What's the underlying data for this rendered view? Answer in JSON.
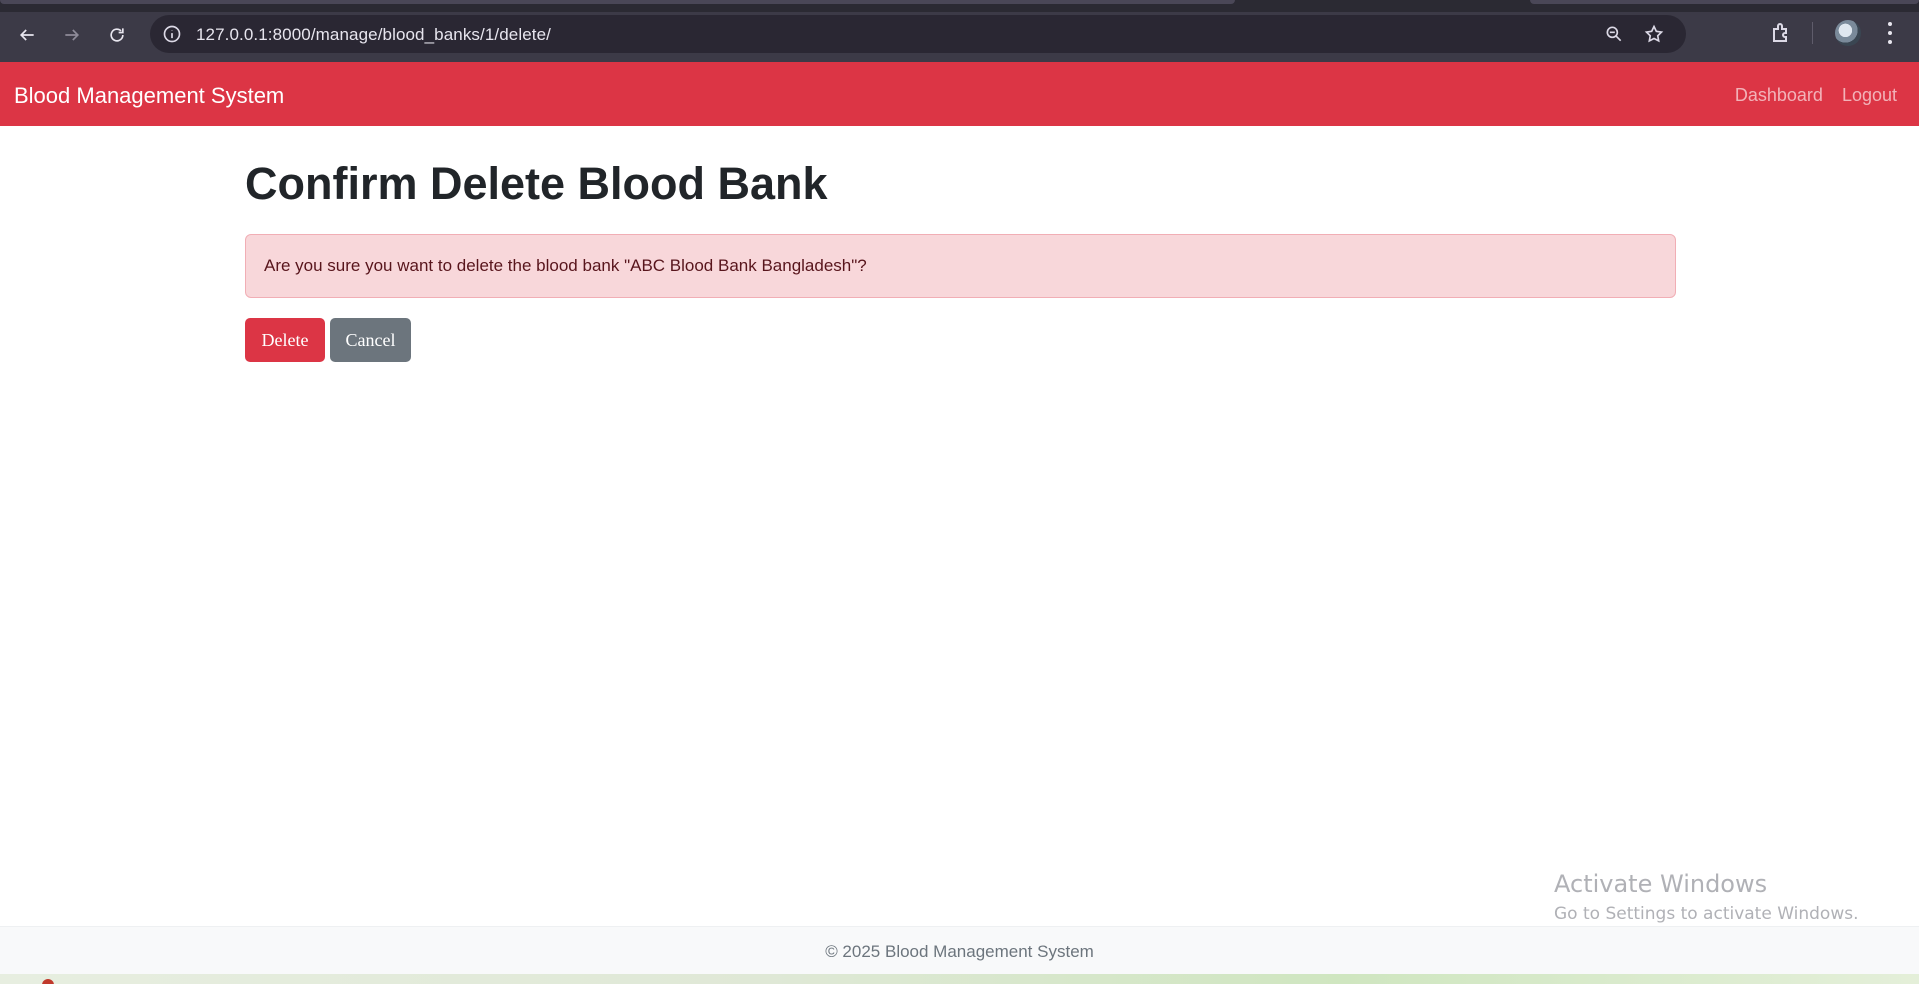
{
  "browser": {
    "url": "127.0.0.1:8000/manage/blood_banks/1/delete/",
    "icons": [
      "back-icon",
      "forward-icon",
      "reload-icon",
      "site-info-icon",
      "zoom-icon",
      "bookmark-star-icon",
      "extensions-icon",
      "profile-avatar",
      "browser-menu-icon"
    ]
  },
  "navbar": {
    "brand": "Blood Management System",
    "links": [
      "Dashboard",
      "Logout"
    ],
    "color": "#dc3545"
  },
  "page": {
    "title": "Confirm Delete Blood Bank",
    "alert_message": "Are you sure you want to delete the blood bank \"ABC Blood Bank Bangladesh\"?",
    "delete_label": "Delete",
    "cancel_label": "Cancel"
  },
  "watermark": {
    "title": "Activate Windows",
    "subtitle": "Go to Settings to activate Windows."
  },
  "footer": {
    "text": "© 2025 Blood Management System"
  }
}
